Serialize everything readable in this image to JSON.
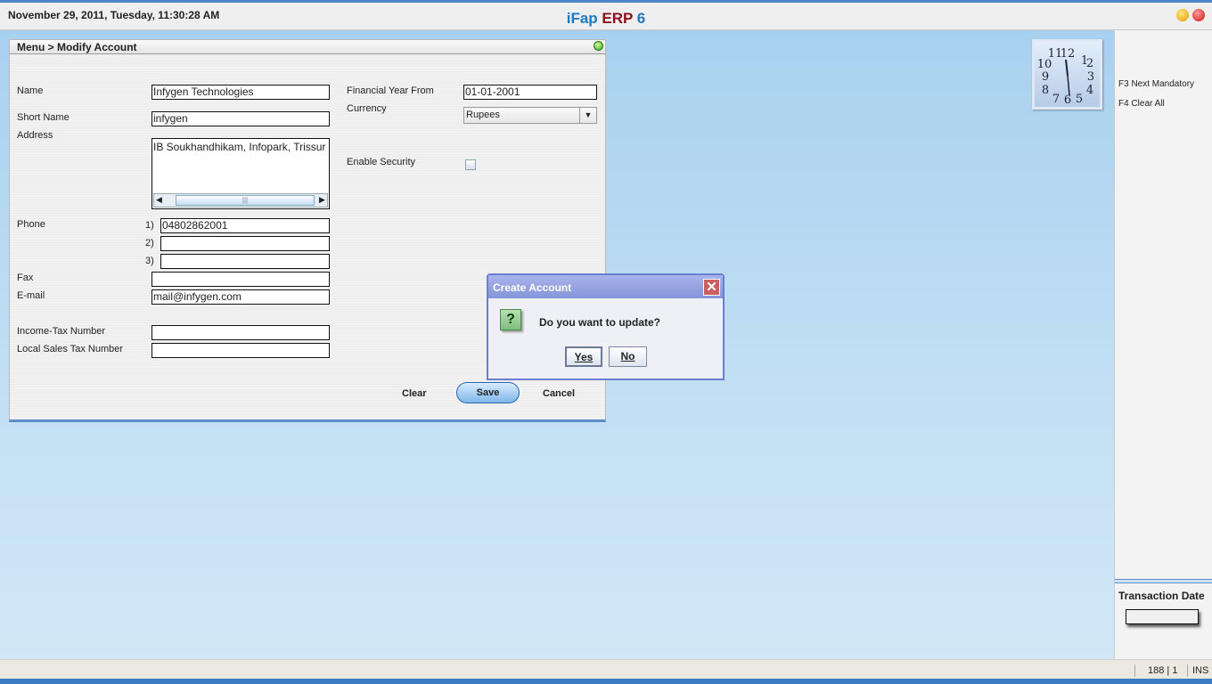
{
  "header": {
    "datetime": "November  29, 2011, Tuesday, 11:30:28 AM",
    "title_part1": "iFap",
    "title_part2": "ERP",
    "title_part3": "6"
  },
  "panel": {
    "breadcrumb": "Menu > Modify Account"
  },
  "form": {
    "name_label": "Name",
    "name_value": "Infygen Technologies",
    "short_name_label": "Short Name",
    "short_name_value": "infygen",
    "address_label": "Address",
    "address_value": "IB Soukhandhikam, Infopark, Trissur",
    "phone_label": "Phone",
    "phone1_prefix": "1)",
    "phone1_value": "04802862001",
    "phone2_prefix": "2)",
    "phone2_value": "",
    "phone3_prefix": "3)",
    "phone3_value": "",
    "fax_label": "Fax",
    "fax_value": "",
    "email_label": "E-mail",
    "email_value": "mail@infygen.com",
    "income_tax_label": "Income-Tax Number",
    "income_tax_value": "",
    "local_sales_tax_label": "Local Sales Tax Number",
    "local_sales_tax_value": "",
    "fy_label": "Financial Year From",
    "fy_value": "01-01-2001",
    "currency_label": "Currency",
    "currency_value": "Rupees",
    "security_label": "Enable Security",
    "security_checked": false
  },
  "buttons": {
    "clear": "Clear",
    "save": "Save",
    "cancel": "Cancel"
  },
  "dialog": {
    "title": "Create Account",
    "message": "Do you want to update?",
    "yes": "Yes",
    "no": "No",
    "icon": "question-icon"
  },
  "shortcuts": [
    "F3 Next Mandatory",
    "F4 Clear All"
  ],
  "transaction": {
    "label": "Transaction Date",
    "value": ""
  },
  "status": {
    "position": "188 | 1",
    "mode": "INS"
  }
}
